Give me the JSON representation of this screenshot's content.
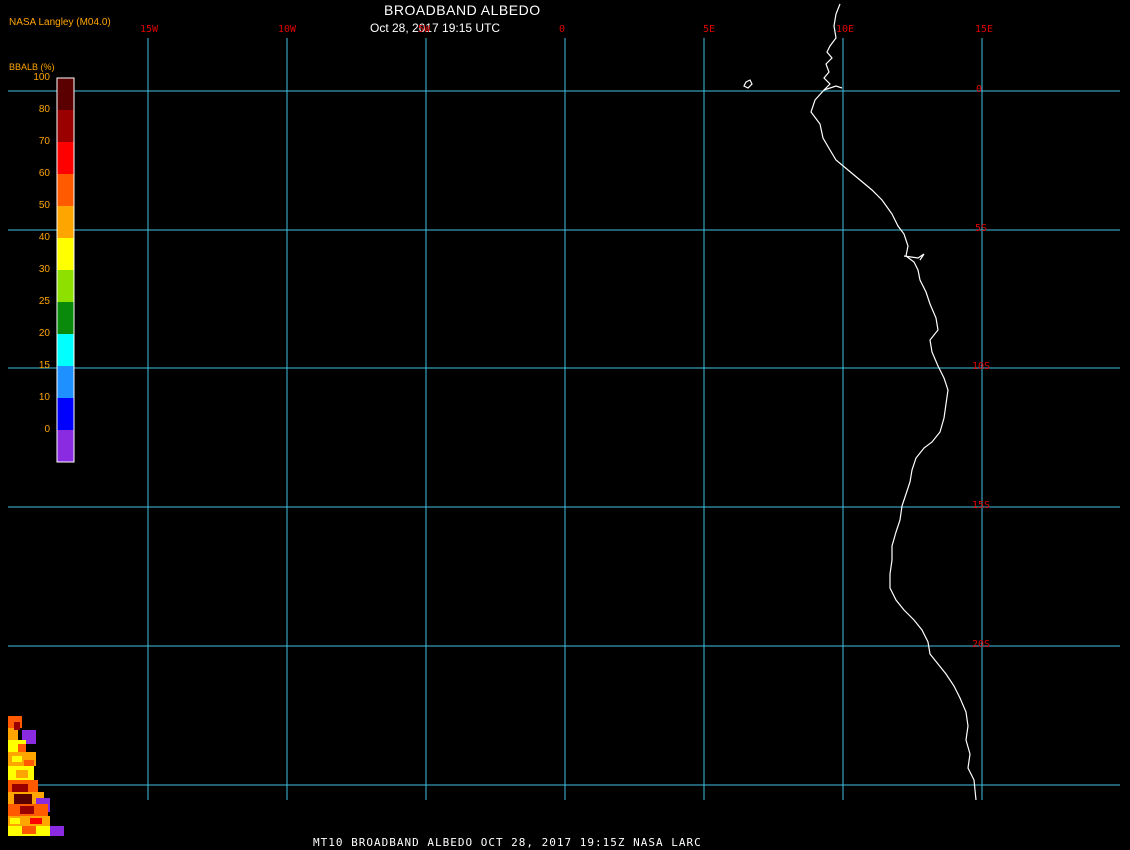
{
  "header": {
    "brand": "NASA Langley (M04.0)",
    "title": "BROADBAND ALBEDO",
    "subtitle": "Oct 28, 2017 19:15 UTC"
  },
  "footer": {
    "text": "MT10  BROADBAND ALBEDO   OCT 28, 2017 19:15Z   NASA LARC"
  },
  "legend": {
    "label": "BBALB (%)",
    "ticks": [
      "100",
      "80",
      "70",
      "60",
      "50",
      "40",
      "30",
      "25",
      "20",
      "15",
      "10",
      "0"
    ],
    "colors": [
      "#5a0000",
      "#9a0000",
      "#ff0000",
      "#ff5a00",
      "#ffa500",
      "#ffff00",
      "#8ee000",
      "#0a8a0a",
      "#00ffff",
      "#1e90ff",
      "#0000ff",
      "#8a2be2"
    ]
  },
  "map": {
    "longitudes": [
      "15W",
      "10W",
      "5W",
      "0",
      "5E",
      "10E",
      "15E"
    ],
    "latitudes": [
      "0",
      "5S",
      "10S",
      "15S",
      "20S"
    ],
    "grid_color": "#40c0e0",
    "coast_color": "#ffffff",
    "label_color": "#e00000"
  }
}
